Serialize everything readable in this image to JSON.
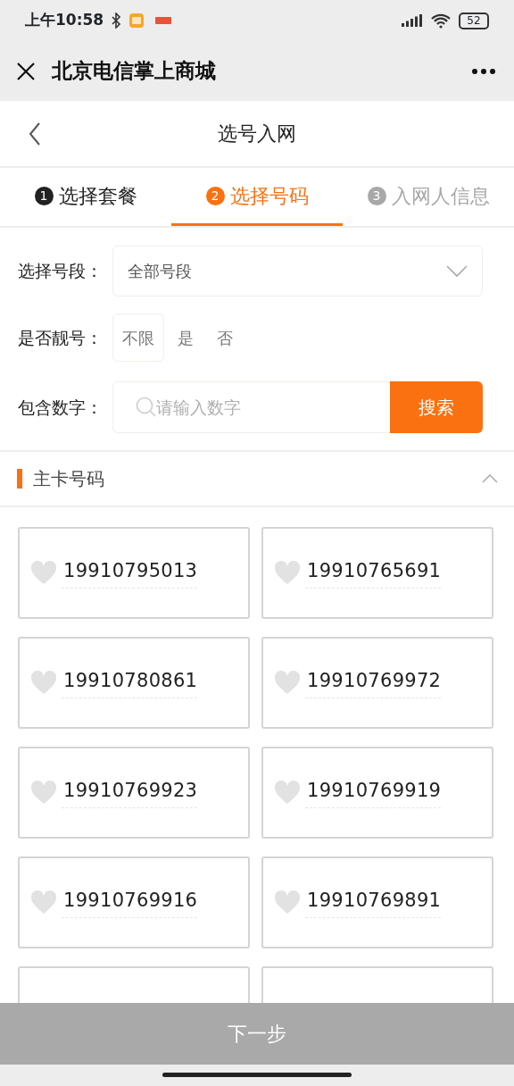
{
  "status_bar": {
    "time": "上午10:58",
    "battery": "52"
  },
  "window": {
    "title": "北京电信掌上商城"
  },
  "header": {
    "title": "选号入网"
  },
  "steps": [
    {
      "number": "1",
      "label": "选择套餐",
      "kind": "done",
      "selected": false
    },
    {
      "number": "2",
      "label": "选择号码",
      "kind": "current",
      "selected": true
    },
    {
      "number": "3",
      "label": "入网人信息",
      "kind": "pending",
      "selected": false
    }
  ],
  "filters": {
    "segment": {
      "label": "选择号段：",
      "value": "全部号段"
    },
    "pretty": {
      "label": "是否靓号：",
      "options": [
        {
          "label": "不限",
          "selected": true
        },
        {
          "label": "是",
          "selected": false
        },
        {
          "label": "否",
          "selected": false
        }
      ]
    },
    "digits": {
      "label": "包含数字：",
      "placeholder": "请输入数字",
      "button": "搜索"
    }
  },
  "section": {
    "title": "主卡号码",
    "expanded": true
  },
  "numbers": [
    {
      "kind": "number",
      "number": "19910795013",
      "favorited": false
    },
    {
      "kind": "number",
      "number": "19910765691",
      "favorited": false
    },
    {
      "kind": "number",
      "number": "19910780861",
      "favorited": false
    },
    {
      "kind": "number",
      "number": "19910769972",
      "favorited": false
    },
    {
      "kind": "number",
      "number": "19910769923",
      "favorited": false
    },
    {
      "kind": "number",
      "number": "19910769919",
      "favorited": false
    },
    {
      "kind": "number",
      "number": "19910769916",
      "favorited": false
    },
    {
      "kind": "number",
      "number": "19910769891",
      "favorited": false
    },
    {
      "kind": "empty"
    },
    {
      "kind": "empty"
    }
  ],
  "next_button": {
    "label": "下一步",
    "disabled": true
  }
}
